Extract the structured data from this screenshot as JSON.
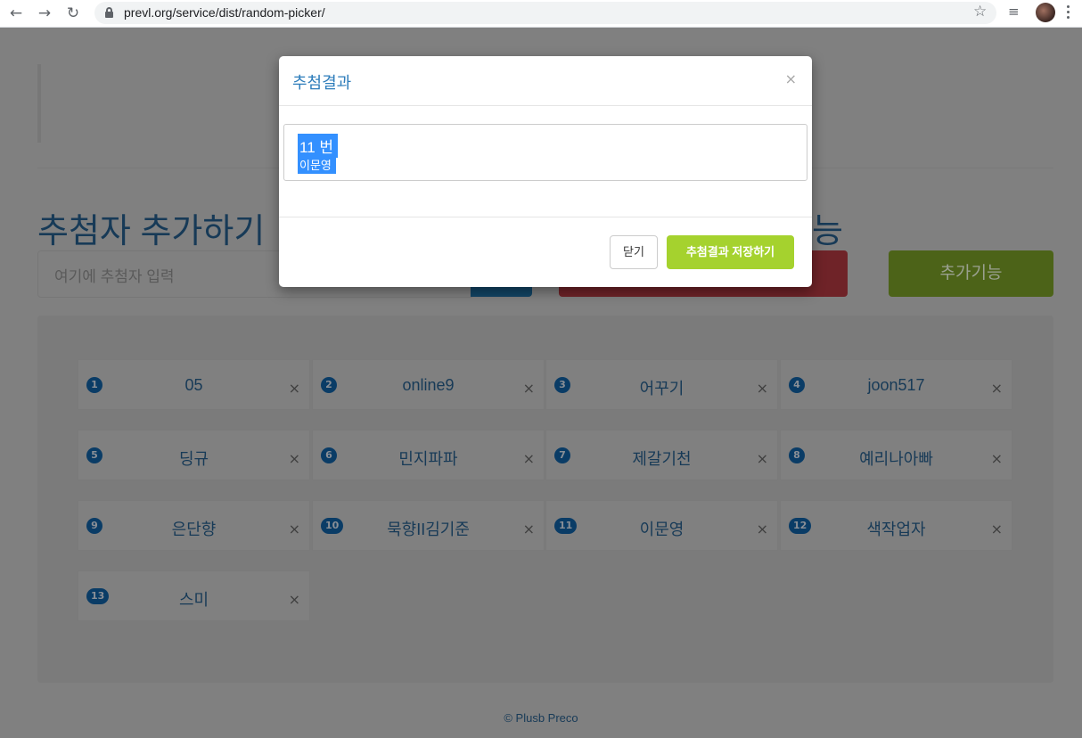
{
  "browser": {
    "url": "prevl.org/service/dist/random-picker/",
    "back_icon": "arrow-left-icon",
    "forward_icon": "arrow-right-icon",
    "reload_icon": "reload-icon"
  },
  "page": {
    "add_title": "추첨자 추가하기",
    "features_title_fragment": "능",
    "input_placeholder": "여기에 추첨자 입력",
    "more_button": "추가기능",
    "footer": "© Plusb Preco",
    "remove_icon_glyph": "×",
    "participants": [
      {
        "num": "1",
        "name": "05"
      },
      {
        "num": "2",
        "name": "online9"
      },
      {
        "num": "3",
        "name": "어꾸기"
      },
      {
        "num": "4",
        "name": "joon517"
      },
      {
        "num": "5",
        "name": "딩규"
      },
      {
        "num": "6",
        "name": "민지파파"
      },
      {
        "num": "7",
        "name": "제갈기천"
      },
      {
        "num": "8",
        "name": "예리나아빠"
      },
      {
        "num": "9",
        "name": "은단향"
      },
      {
        "num": "10",
        "name": "묵향II김기준"
      },
      {
        "num": "11",
        "name": "이문영"
      },
      {
        "num": "12",
        "name": "색작업자"
      },
      {
        "num": "13",
        "name": "스미"
      }
    ]
  },
  "modal": {
    "title": "추첨결과",
    "close_glyph": "×",
    "result_number": "11 번",
    "result_name": "이문영",
    "close_button": "닫기",
    "save_button": "추첨결과 저장하기"
  },
  "colors": {
    "accent_blue": "#2e7dbb",
    "save_green": "#a5d22e",
    "selection_blue": "#3390ff",
    "overlay": "#808080"
  }
}
